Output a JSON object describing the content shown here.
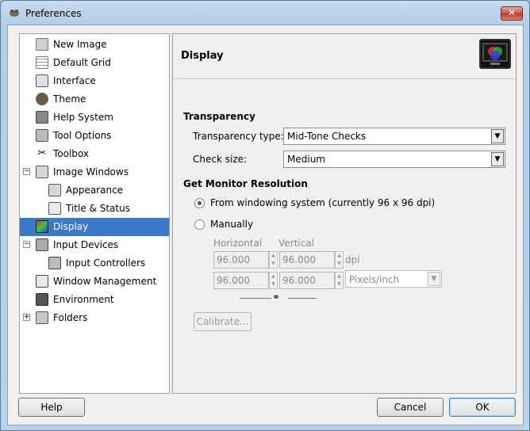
{
  "window": {
    "title": "Preferences",
    "close_label": "✕"
  },
  "tree": {
    "items": [
      {
        "label": "New Image"
      },
      {
        "label": "Default Grid"
      },
      {
        "label": "Interface"
      },
      {
        "label": "Theme"
      },
      {
        "label": "Help System"
      },
      {
        "label": "Tool Options"
      },
      {
        "label": "Toolbox"
      },
      {
        "label": "Image Windows",
        "expander": "−"
      },
      {
        "label": "Appearance"
      },
      {
        "label": "Title & Status"
      },
      {
        "label": "Display",
        "selected": true
      },
      {
        "label": "Input Devices",
        "expander": "−"
      },
      {
        "label": "Input Controllers"
      },
      {
        "label": "Window Management"
      },
      {
        "label": "Environment"
      },
      {
        "label": "Folders",
        "expander": "+"
      }
    ]
  },
  "panel": {
    "title": "Display",
    "transparency": {
      "heading": "Transparency",
      "type_label": "Transparency type:",
      "type_value": "Mid-Tone Checks",
      "check_size_label": "Check size:",
      "check_size_value": "Medium"
    },
    "monitor": {
      "heading": "Get Monitor Resolution",
      "from_system_label": "From windowing system (currently 96 x 96 dpi)",
      "manually_label": "Manually",
      "horizontal_label": "Horizontal",
      "vertical_label": "Vertical",
      "h_value_1": "96.000",
      "v_value_1": "96.000",
      "h_value_2": "96.000",
      "v_value_2": "96.000",
      "dpi_label": "dpi",
      "unit_value": "Pixels/inch",
      "calibrate_label": "Calibrate..."
    }
  },
  "footer": {
    "help_label": "Help",
    "cancel_label": "Cancel",
    "ok_label": "OK"
  },
  "colors": {
    "selection": "#3a78c8",
    "titlebar": "#b9d1e9"
  }
}
